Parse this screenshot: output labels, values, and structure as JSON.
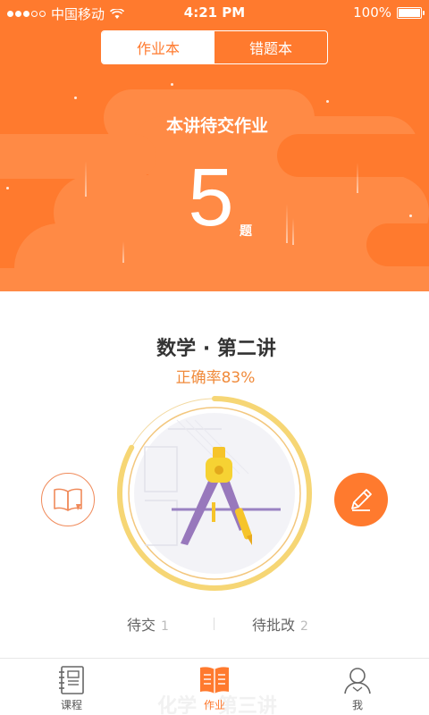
{
  "status_bar": {
    "carrier": "中国移动",
    "time": "4:21 PM",
    "battery": "100%"
  },
  "segment": {
    "tabs": [
      {
        "label": "作业本",
        "active": true
      },
      {
        "label": "错题本",
        "active": false
      }
    ]
  },
  "hero": {
    "title": "本讲待交作业",
    "count": "5",
    "unit": "题"
  },
  "lesson": {
    "title": "数学 · 第二讲",
    "accuracy": "正确率83%",
    "accuracy_value": 83
  },
  "stats": [
    {
      "label": "待交",
      "count": "1"
    },
    {
      "label": "待批改",
      "count": "2"
    }
  ],
  "next_lesson_peek": "化学 · 第三讲",
  "tab_bar": {
    "items": [
      {
        "label": "课程",
        "icon": "notebook-icon",
        "active": false
      },
      {
        "label": "作业",
        "icon": "open-book-icon",
        "active": true
      },
      {
        "label": "我",
        "icon": "user-icon",
        "active": false
      }
    ]
  },
  "colors": {
    "accent": "#FF7A2E",
    "accuracy_text": "#F08A3A",
    "progress_ring": "#F6D675"
  },
  "icons": {
    "left_action": "book-icon",
    "right_action": "pencil-icon",
    "center_illustration": "compass-icon"
  }
}
